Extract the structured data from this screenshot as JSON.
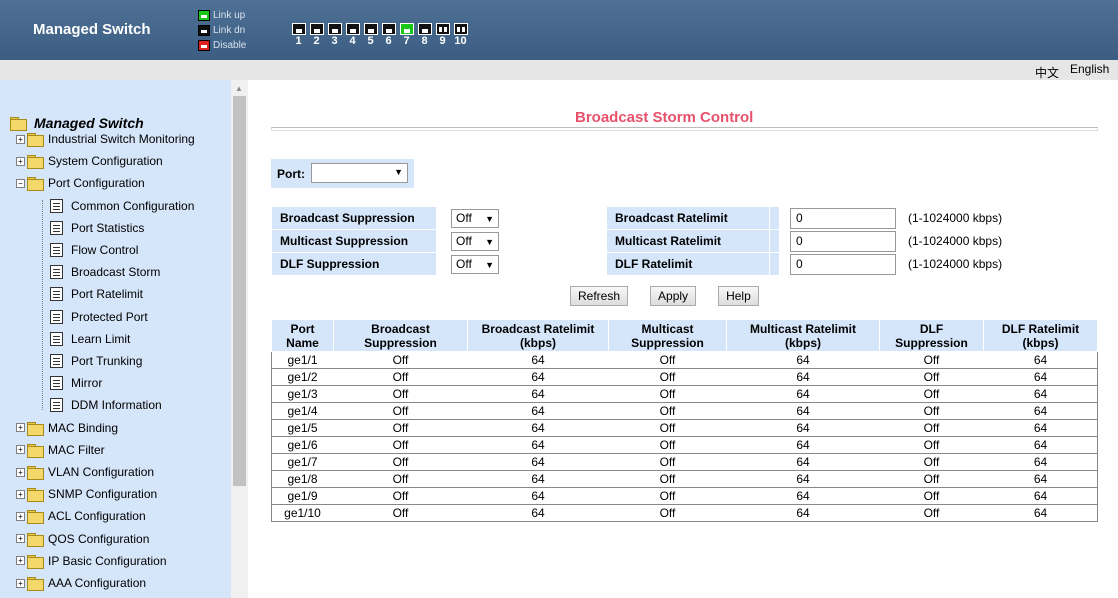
{
  "header": {
    "brand": "Managed Switch",
    "legend": [
      {
        "label": "Link up",
        "color": "#17c617",
        "icon": "port-link-up-icon"
      },
      {
        "label": "Link dn",
        "color": "#111111",
        "icon": "port-link-down-icon"
      },
      {
        "label": "Disable",
        "color": "#e02020",
        "icon": "port-disable-icon"
      }
    ],
    "ports": [
      {
        "num": "1",
        "state": "down"
      },
      {
        "num": "2",
        "state": "down"
      },
      {
        "num": "3",
        "state": "down"
      },
      {
        "num": "4",
        "state": "down"
      },
      {
        "num": "5",
        "state": "down"
      },
      {
        "num": "6",
        "state": "down"
      },
      {
        "num": "7",
        "state": "up"
      },
      {
        "num": "8",
        "state": "down"
      },
      {
        "num": "9",
        "state": "fiber"
      },
      {
        "num": "10",
        "state": "fiber"
      }
    ]
  },
  "lang": {
    "chinese": "中文",
    "english": "English"
  },
  "sidebar": {
    "root": "Managed Switch",
    "items": [
      {
        "label": "Industrial Switch Monitoring",
        "type": "folder",
        "level": 0
      },
      {
        "label": "System Configuration",
        "type": "folder",
        "level": 0
      },
      {
        "label": "Port Configuration",
        "type": "folder-open",
        "level": 0
      },
      {
        "label": "Common Configuration",
        "type": "doc",
        "level": 1
      },
      {
        "label": "Port Statistics",
        "type": "doc",
        "level": 1
      },
      {
        "label": "Flow Control",
        "type": "doc",
        "level": 1
      },
      {
        "label": "Broadcast Storm",
        "type": "doc",
        "level": 1
      },
      {
        "label": "Port Ratelimit",
        "type": "doc",
        "level": 1
      },
      {
        "label": "Protected Port",
        "type": "doc",
        "level": 1
      },
      {
        "label": "Learn Limit",
        "type": "doc",
        "level": 1
      },
      {
        "label": "Port Trunking",
        "type": "doc",
        "level": 1
      },
      {
        "label": "Mirror",
        "type": "doc",
        "level": 1
      },
      {
        "label": "DDM Information",
        "type": "doc",
        "level": 1
      },
      {
        "label": "MAC Binding",
        "type": "folder",
        "level": 0
      },
      {
        "label": "MAC Filter",
        "type": "folder",
        "level": 0
      },
      {
        "label": "VLAN Configuration",
        "type": "folder",
        "level": 0
      },
      {
        "label": "SNMP Configuration",
        "type": "folder",
        "level": 0
      },
      {
        "label": "ACL Configuration",
        "type": "folder",
        "level": 0
      },
      {
        "label": "QOS Configuration",
        "type": "folder",
        "level": 0
      },
      {
        "label": "IP Basic Configuration",
        "type": "folder",
        "level": 0
      },
      {
        "label": "AAA Configuration",
        "type": "folder",
        "level": 0
      }
    ]
  },
  "main": {
    "title": "Broadcast Storm Control",
    "port_label": "Port:",
    "port_value": "",
    "limits": [
      {
        "sup_label": "Broadcast Suppression",
        "sup_value": "Off",
        "rate_label": "Broadcast Ratelimit",
        "rate_value": "0",
        "range": "(1-1024000 kbps)"
      },
      {
        "sup_label": "Multicast Suppression",
        "sup_value": "Off",
        "rate_label": "Multicast Ratelimit",
        "rate_value": "0",
        "range": "(1-1024000 kbps)"
      },
      {
        "sup_label": "DLF Suppression",
        "sup_value": "Off",
        "rate_label": "DLF Ratelimit",
        "rate_value": "0",
        "range": "(1-1024000 kbps)"
      }
    ],
    "buttons": {
      "refresh": "Refresh",
      "apply": "Apply",
      "help": "Help"
    },
    "table": {
      "headers": [
        [
          "Port",
          "Name"
        ],
        [
          "Broadcast",
          "Suppression"
        ],
        [
          "Broadcast Ratelimit",
          "(kbps)"
        ],
        [
          "Multicast",
          "Suppression"
        ],
        [
          "Multicast Ratelimit",
          "(kbps)"
        ],
        [
          "DLF",
          "Suppression"
        ],
        [
          "DLF Ratelimit",
          "(kbps)"
        ]
      ],
      "rows": [
        [
          "ge1/1",
          "Off",
          "64",
          "Off",
          "64",
          "Off",
          "64"
        ],
        [
          "ge1/2",
          "Off",
          "64",
          "Off",
          "64",
          "Off",
          "64"
        ],
        [
          "ge1/3",
          "Off",
          "64",
          "Off",
          "64",
          "Off",
          "64"
        ],
        [
          "ge1/4",
          "Off",
          "64",
          "Off",
          "64",
          "Off",
          "64"
        ],
        [
          "ge1/5",
          "Off",
          "64",
          "Off",
          "64",
          "Off",
          "64"
        ],
        [
          "ge1/6",
          "Off",
          "64",
          "Off",
          "64",
          "Off",
          "64"
        ],
        [
          "ge1/7",
          "Off",
          "64",
          "Off",
          "64",
          "Off",
          "64"
        ],
        [
          "ge1/8",
          "Off",
          "64",
          "Off",
          "64",
          "Off",
          "64"
        ],
        [
          "ge1/9",
          "Off",
          "64",
          "Off",
          "64",
          "Off",
          "64"
        ],
        [
          "ge1/10",
          "Off",
          "64",
          "Off",
          "64",
          "Off",
          "64"
        ]
      ]
    }
  }
}
